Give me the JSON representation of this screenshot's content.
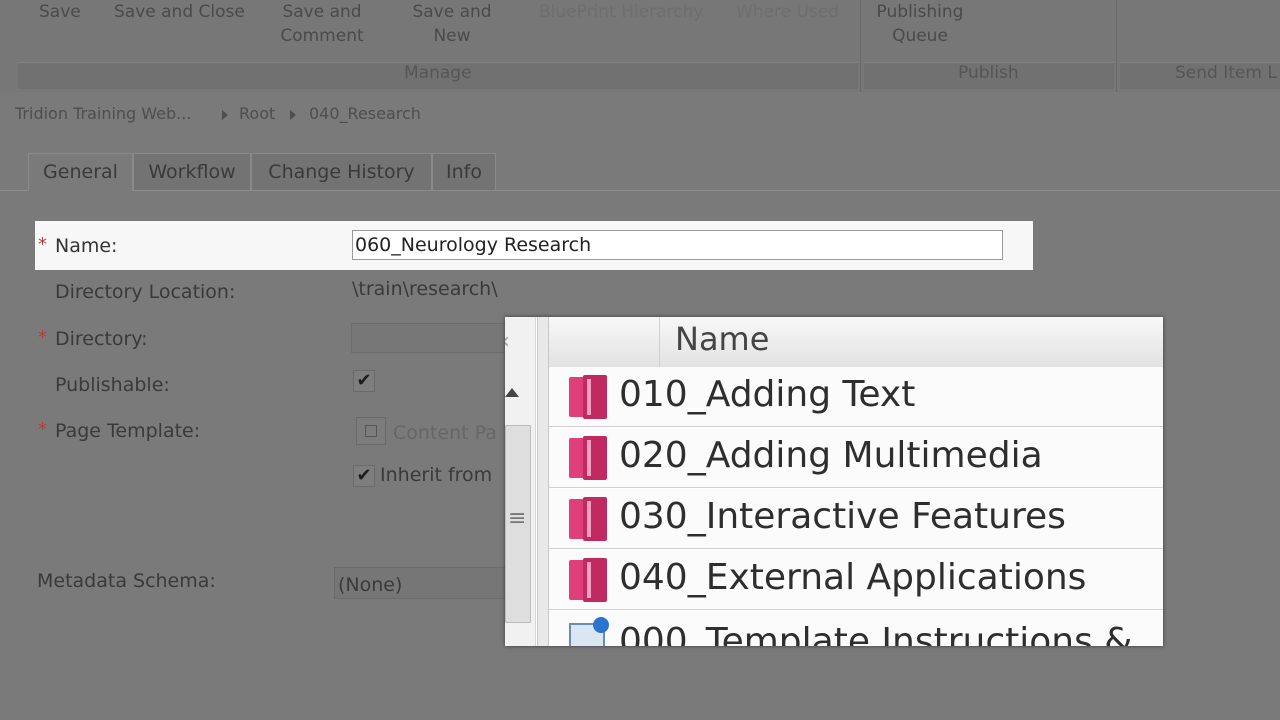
{
  "ribbon": {
    "buttons": [
      "Save",
      "Save and Close",
      "Save and\nComment",
      "Save and\nNew",
      "BluePrint Hierarchy",
      "Where Used",
      "Publishing\nQueue"
    ],
    "groups": [
      "Manage",
      "Publish",
      "Send Item L"
    ]
  },
  "breadcrumb": [
    "Tridion Training Web...",
    "Root",
    "040_Research"
  ],
  "tabs": [
    "General",
    "Workflow",
    "Change History",
    "Info"
  ],
  "form": {
    "name_label": "Name:",
    "name_value": "060_Neurology Research",
    "directory_location_label": "Directory Location:",
    "directory_location_value": "\\train\\research\\",
    "directory_label": "Directory:",
    "publishable_label": "Publishable:",
    "page_template_label": "Page Template:",
    "page_template_value": "Content Pa",
    "inherit_label": "Inherit from",
    "metadata_schema_label": "Metadata Schema:",
    "metadata_schema_value": "(None)",
    "required_marker": "*",
    "check_mark": "✔"
  },
  "popup": {
    "column_header": "Name",
    "items": [
      {
        "label": "010_Adding Text",
        "icon": "folder-icon"
      },
      {
        "label": "020_Adding Multimedia",
        "icon": "folder-icon"
      },
      {
        "label": "030_Interactive Features",
        "icon": "folder-icon"
      },
      {
        "label": "040_External Applications",
        "icon": "folder-icon"
      },
      {
        "label": "000_Template Instructions &",
        "icon": "template-icon"
      }
    ]
  },
  "colors": {
    "overlay_gray": "#7a7a7a",
    "folder_pink": "#d93472",
    "required_red": "#b04040"
  }
}
